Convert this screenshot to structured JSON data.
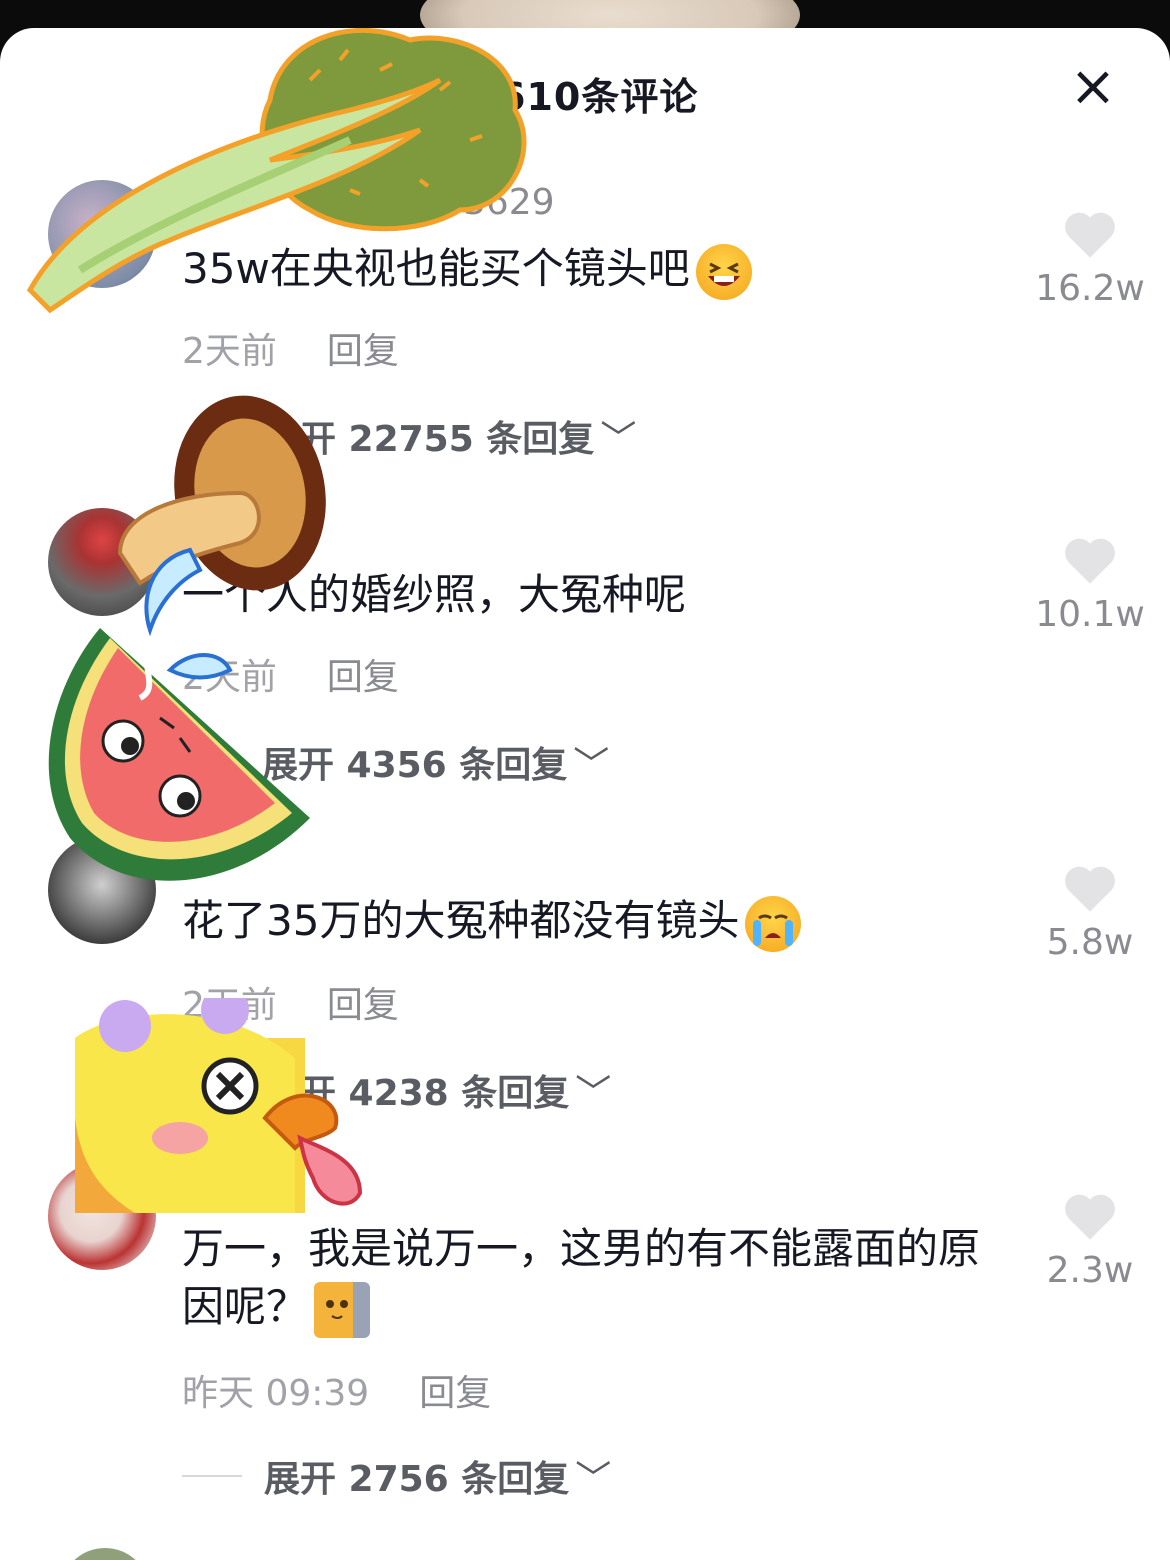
{
  "header": {
    "title": "1610条评论",
    "close_label": "×"
  },
  "comments": [
    {
      "username": "53629",
      "text": "35w在央视也能买个镜头吧",
      "emoji": "laughing-emoji",
      "time": "2天前",
      "reply": "回复",
      "likes": "16.2w",
      "expand": "开 22755 条回复"
    },
    {
      "username": "",
      "text": "一个人的婚纱照，大冤种呢",
      "time": "2天前",
      "reply": "回复",
      "likes": "10.1w",
      "expand": "展开 4356 条回复"
    },
    {
      "username": "",
      "text": "花了35万的大冤种都没有镜头",
      "emoji": "crying-emoji",
      "time": "2天前",
      "reply": "回复",
      "likes": "5.8w",
      "expand": "开 4238 条回复"
    },
    {
      "username": "",
      "text": "万一，我是说万一，这男的有不能露面的原因呢？",
      "emoji": "cat-peeking-emoji",
      "time": "昨天 09:39",
      "reply": "回复",
      "likes": "2.3w",
      "expand": "展开 2756 条回复"
    }
  ],
  "colors": {
    "text": "#161823",
    "muted": "#a1a2a7",
    "heart": "#e3e3e5"
  }
}
